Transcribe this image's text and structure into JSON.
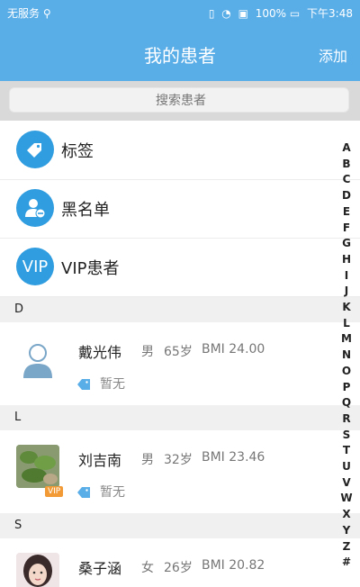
{
  "status_bar": {
    "carrier": "无服务",
    "battery": "100%",
    "time": "下午3:48"
  },
  "nav": {
    "title": "我的患者",
    "add_label": "添加"
  },
  "search": {
    "placeholder": "搜索患者"
  },
  "menu": [
    {
      "label": "标签",
      "icon": "tag-icon"
    },
    {
      "label": "黑名单",
      "icon": "blacklist-user-icon"
    },
    {
      "label": "VIP患者",
      "icon": "vip-icon",
      "icon_text": "VIP"
    }
  ],
  "sections": [
    {
      "letter": "D",
      "patients": [
        {
          "name": "戴光伟",
          "gender": "男",
          "age": "65岁",
          "bmi": "BMI 24.00",
          "tag": "暂无",
          "avatar": "default-person-avatar"
        }
      ]
    },
    {
      "letter": "L",
      "patients": [
        {
          "name": "刘吉南",
          "gender": "男",
          "age": "32岁",
          "bmi": "BMI 23.46",
          "tag": "暂无",
          "avatar": "plant-photo-avatar",
          "badge": "VIP"
        }
      ]
    },
    {
      "letter": "S",
      "patients": [
        {
          "name": "桑子涵",
          "gender": "女",
          "age": "26岁",
          "bmi": "BMI 20.82",
          "avatar": "girl-photo-avatar"
        }
      ]
    }
  ],
  "index_letters": [
    "A",
    "B",
    "C",
    "D",
    "E",
    "F",
    "G",
    "H",
    "I",
    "J",
    "K",
    "L",
    "M",
    "N",
    "O",
    "P",
    "Q",
    "R",
    "S",
    "T",
    "U",
    "V",
    "W",
    "X",
    "Y",
    "Z",
    "#"
  ],
  "colors": {
    "header": "#5aaee8",
    "accent": "#2f9de0",
    "section_bg": "#f0f0f0",
    "vip_badge": "#f29b36"
  }
}
